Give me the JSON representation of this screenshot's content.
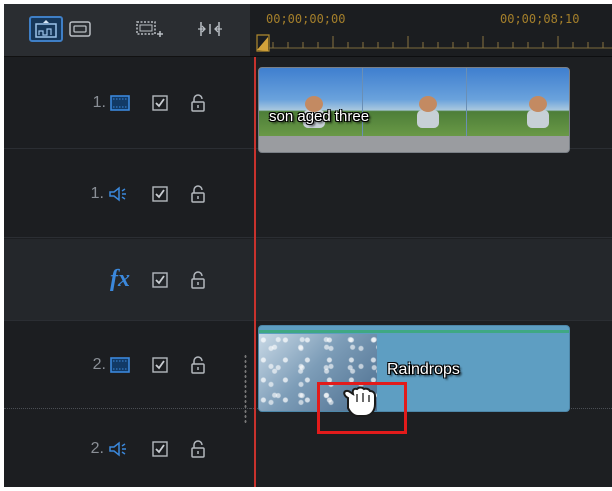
{
  "toolbar": {
    "buttons": [
      {
        "name": "storyboard-view",
        "icon": "storyboard-icon",
        "active": true
      },
      {
        "name": "timeline-view",
        "icon": "timeline-view-icon",
        "active": false
      },
      {
        "name": "chapters",
        "icon": "add-chapter-icon",
        "active": false
      },
      {
        "name": "fit-timeline",
        "icon": "fit-timeline-icon",
        "active": false
      }
    ]
  },
  "ruler": {
    "start_timecode": "00;00;00;00",
    "end_timecode": "00;00;08;10"
  },
  "tracks": [
    {
      "id": "v1",
      "number": "1.",
      "kind": "video",
      "icon": "video-track-icon",
      "enabled": true,
      "locked": false
    },
    {
      "id": "a1",
      "number": "1.",
      "kind": "audio",
      "icon": "audio-track-icon",
      "enabled": true,
      "locked": false
    },
    {
      "id": "fx",
      "number": "",
      "kind": "effect",
      "label": "fx",
      "enabled": true,
      "locked": false
    },
    {
      "id": "v2",
      "number": "2.",
      "kind": "video",
      "icon": "video-track-icon",
      "enabled": true,
      "locked": false
    },
    {
      "id": "a2",
      "number": "2.",
      "kind": "audio",
      "icon": "audio-track-icon",
      "enabled": true,
      "locked": false
    }
  ],
  "clips": {
    "video_clip": {
      "title": "son aged three",
      "track": "v1"
    },
    "overlay_clip": {
      "title": "Raindrops",
      "track": "v2"
    }
  },
  "colors": {
    "background": "#1c1e21",
    "accent_blue": "#3b88dc",
    "timecode": "#a47f2b",
    "playhead": "#c8322d",
    "overlay_clip": "#5e9ec2",
    "highlight": "#e21b1b"
  },
  "cursor": {
    "icon": "grab-hand-icon"
  }
}
